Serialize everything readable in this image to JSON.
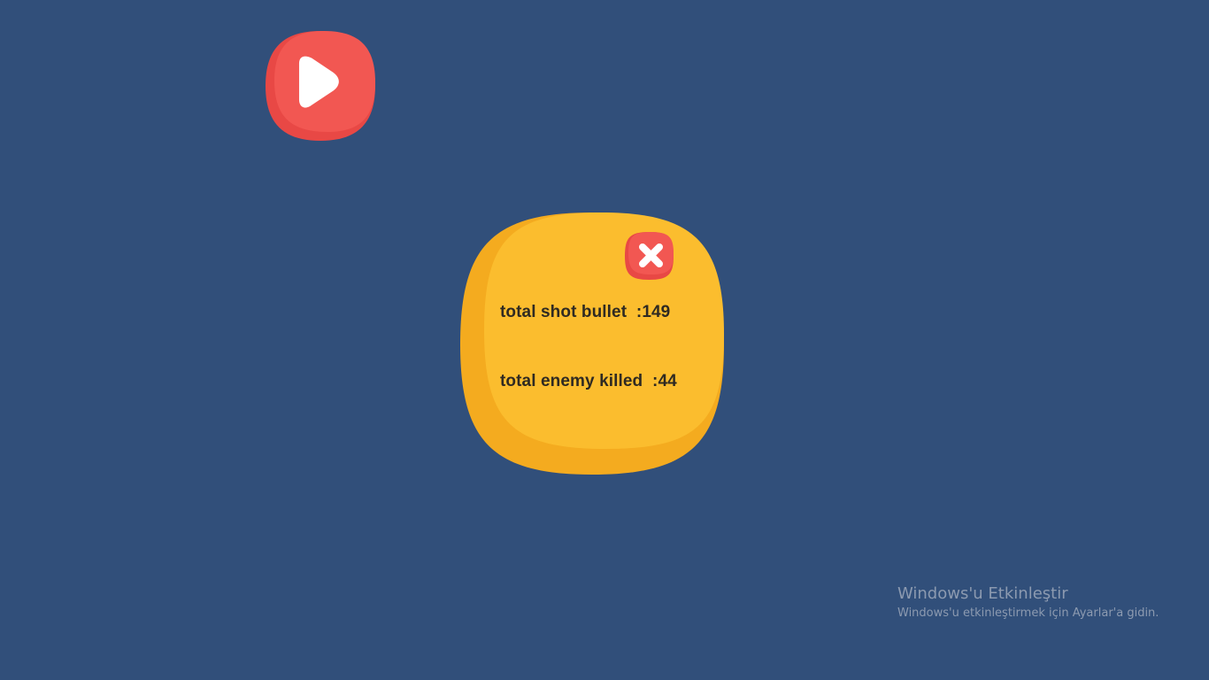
{
  "game": {
    "play_button": {
      "icon": "play-icon",
      "color": "#ef5350"
    },
    "stats_panel": {
      "color": "#fbbd2e",
      "close_button": {
        "icon": "close-icon",
        "color": "#ef5350"
      },
      "shots_label": "total shot bullet",
      "shots_value": ":149",
      "kills_label": "total enemy killed",
      "kills_value": ":44"
    }
  },
  "watermark": {
    "title": "Windows'u Etkinleştir",
    "subtitle": "Windows'u etkinleştirmek için Ayarlar'a gidin."
  }
}
